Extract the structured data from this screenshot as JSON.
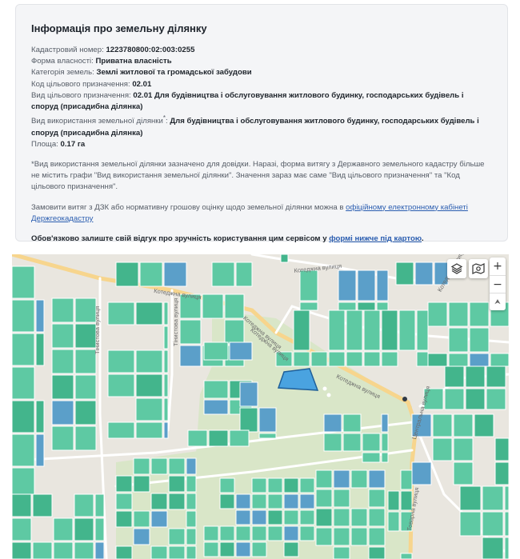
{
  "info": {
    "title": "Інформація про земельну ділянку",
    "cadastral": {
      "label": "Кадастровий номер:",
      "value": "1223780800:02:003:0255"
    },
    "ownership": {
      "label": "Форма власності:",
      "value": "Приватна власність"
    },
    "category": {
      "label": "Категорія земель:",
      "value": "Землі житлової та громадської забудови"
    },
    "purpose_code": {
      "label": "Код цільового призначення:",
      "value": "02.01"
    },
    "purpose_type": {
      "label": "Вид цільового призначення:",
      "value": "02.01 Для будівництва і обслуговування житлового будинку, господарських будівель і споруд (присадибна ділянка)"
    },
    "usage_type": {
      "label": "Вид використання земельної ділянки",
      "asterisk": "*",
      "colon": ":",
      "value": "Для будівництва і обслуговування житлового будинку, господарських будівель і споруд (присадибна ділянка)"
    },
    "area": {
      "label": "Площа:",
      "value": "0.17 га"
    },
    "note": "*Вид використання земельної ділянки зазначено для довідки. Наразі, форма витягу з Державного земельного кадастру більше не містить графи \"Вид використання земельної ділянки\". Значення зараз має саме \"Вид цільового призначення\" та \"Код цільового призначення\".",
    "order_text": "Замовити витяг з ДЗК або нормативну грошову оцінку щодо земельної ділянки можна в ",
    "order_link": "офіційному електронному кабінеті Держгеокадастру",
    "feedback_text": "Обов'язково залиште свій відгук про зручність користування цим сервісом у ",
    "feedback_link": "формі нижче під картою",
    "feedback_end": "."
  },
  "map": {
    "zoom_in": "+",
    "zoom_out": "−",
    "north": "⮝",
    "layers_icon": "layers-icon",
    "legend_icon": "map-legend-icon",
    "streets": {
      "kotedzhna_1": "Котеджна вулиця",
      "kotedzhna_2": "Котеджна вулиця",
      "kotedzhna_3": "Котеджна вулиця",
      "kotedzhna_4": "Котеджна вулиця",
      "kotedzhna_5": "Котеджна вулиця",
      "tsentralna": "Центральна вулиця",
      "tiniova": "Тінистова вулиця",
      "tiniova_2": "Тінистова вулиця",
      "kotedzhna_side": "Котеджна вулиця",
      "tovarna": "Товарна вулиця"
    },
    "colors": {
      "parcel": "#5ec9a3",
      "parcel_dark": "#43b58c",
      "parcel_blue": "#5b9fc9",
      "selected": "#4aa3e0",
      "background": "#e9e6df",
      "park": "#d9e6c8",
      "road": "#ffffff",
      "road_major": "#f7d58d"
    }
  }
}
